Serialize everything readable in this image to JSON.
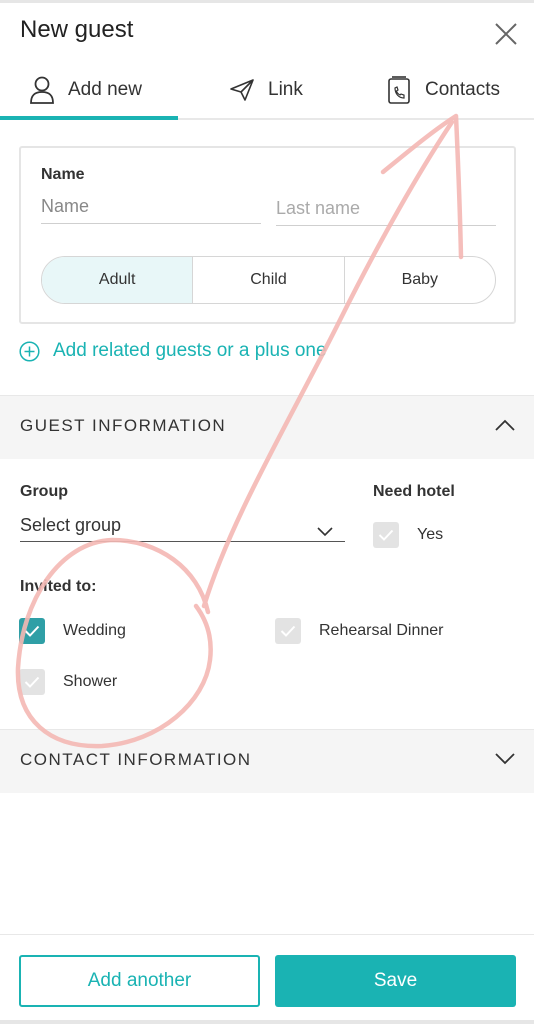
{
  "header": {
    "title": "New guest"
  },
  "tabs": [
    {
      "label": "Add new",
      "icon": "person-icon",
      "active": true
    },
    {
      "label": "Link",
      "icon": "paper-plane-icon",
      "active": false
    },
    {
      "label": "Contacts",
      "icon": "contacts-book-icon",
      "active": false
    }
  ],
  "name_card": {
    "label": "Name",
    "first_placeholder": "Name",
    "last_placeholder": "Last name",
    "age_options": [
      "Adult",
      "Child",
      "Baby"
    ],
    "selected_age": "Adult"
  },
  "add_related": {
    "label": "Add related guests or a plus one",
    "icon": "plus-circle-icon"
  },
  "guest_info": {
    "title": "GUEST INFORMATION",
    "expanded": true,
    "group_label": "Group",
    "group_value": "Select group",
    "hotel_label": "Need hotel",
    "hotel_option": "Yes",
    "hotel_checked": false,
    "invited_label": "Invited to:",
    "events": [
      {
        "label": "Wedding",
        "checked": true
      },
      {
        "label": "Rehearsal Dinner",
        "checked": false
      },
      {
        "label": "Shower",
        "checked": false
      }
    ]
  },
  "contact_info": {
    "title": "CONTACT INFORMATION",
    "expanded": false
  },
  "footer": {
    "add_another": "Add another",
    "save": "Save"
  },
  "colors": {
    "accent": "#1ab3b3",
    "checkbox_on": "#2f9fa6",
    "annotation": "#f4b8b4"
  }
}
